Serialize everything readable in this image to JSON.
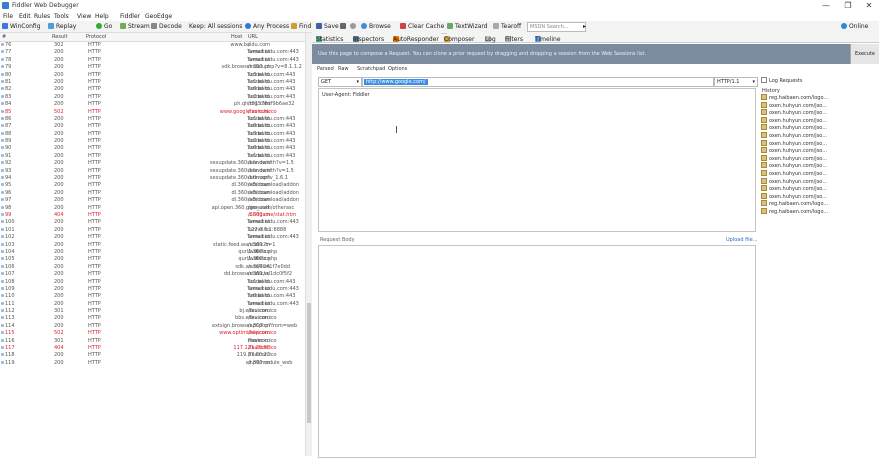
{
  "window": {
    "title": "Fiddler Web Debugger",
    "minimize": "—",
    "maximize": "❐",
    "close": "✕"
  },
  "menu": [
    "File",
    "Edit",
    "Rules",
    "Tools",
    "View",
    "Help",
    "Fiddler",
    "GeoEdge"
  ],
  "toolbar": {
    "winconfig": "WinConfig",
    "replay": "Replay",
    "go": "Go",
    "stream": "Stream",
    "decode": "Decode",
    "keep": "Keep: All sessions",
    "any_process": "Any Process",
    "find": "Find",
    "save": "Save",
    "browse": "Browse",
    "clear_cache": "Clear Cache",
    "textwizard": "TextWizard",
    "tearoff": "Tearoff",
    "search_placeholder": "MSDN Search...",
    "online": "Online"
  },
  "session_columns": [
    "#",
    "Result",
    "Protocol",
    "Host",
    "URL"
  ],
  "sessions": [
    [
      "76",
      "302",
      "HTTP",
      "www.baidu.com",
      "/"
    ],
    [
      "77",
      "200",
      "HTTP",
      "Tunnel to",
      "www.baidu.com:443"
    ],
    [
      "78",
      "200",
      "HTTP",
      "Tunnel to",
      "www.baidu.com:443"
    ],
    [
      "79",
      "200",
      "HTTP",
      "sdk.browser.360.cn",
      "/index.php?v=8.1.1.2"
    ],
    [
      "80",
      "200",
      "HTTP",
      "Tunnel to",
      "ss3.baidu.com:443"
    ],
    [
      "81",
      "200",
      "HTTP",
      "Tunnel to",
      "ss1.baidu.com:443"
    ],
    [
      "82",
      "200",
      "HTTP",
      "Tunnel to",
      "ss0.baidu.com:443"
    ],
    [
      "83",
      "200",
      "HTTP",
      "Tunnel to",
      "ss2.baidu.com:443"
    ],
    [
      "84",
      "200",
      "HTTP",
      "ph.qhimg.com",
      "/t01576df9b6ae32"
    ],
    [
      "85",
      "502",
      "HTTP",
      "www.google.com.hk",
      "/favicon.ico"
    ],
    [
      "86",
      "200",
      "HTTP",
      "Tunnel to",
      "ss1.baidu.com:443"
    ],
    [
      "87",
      "200",
      "HTTP",
      "Tunnel to",
      "ss0.baidu.com:443"
    ],
    [
      "88",
      "200",
      "HTTP",
      "Tunnel to",
      "ss3.baidu.com:443"
    ],
    [
      "89",
      "200",
      "HTTP",
      "Tunnel to",
      "ss2.baidu.com:443"
    ],
    [
      "90",
      "200",
      "HTTP",
      "Tunnel to",
      "ss0.baidu.com:443"
    ],
    [
      "91",
      "200",
      "HTTP",
      "Tunnel to",
      "ss1.baidu.com:443"
    ],
    [
      "92",
      "200",
      "HTTP",
      "sexupdate.360safe.com",
      "/bandwidth?v=1.5"
    ],
    [
      "93",
      "200",
      "HTTP",
      "sexupdate.360safe.com",
      "/bandwidth?v=1.5"
    ],
    [
      "94",
      "200",
      "HTTP",
      "sexupdate.360safe.com",
      "/bdmap?v_1.6.1"
    ],
    [
      "95",
      "200",
      "HTTP",
      "dl.360safe.com",
      "/v3/download/addon"
    ],
    [
      "96",
      "200",
      "HTTP",
      "dl.360safe.com",
      "/v3/download/addon"
    ],
    [
      "97",
      "200",
      "HTTP",
      "dl.360safe.com",
      "/v3/download/addon"
    ],
    [
      "98",
      "200",
      "HTTP",
      "api.open.360.game.net",
      "/gw_auth/otherasc"
    ],
    [
      "99",
      "404",
      "HTTP",
      "s.360.cn",
      "/360game/stat.htm"
    ],
    [
      "100",
      "200",
      "HTTP",
      "Tunnel to",
      "www.baidu.com:443"
    ],
    [
      "101",
      "200",
      "HTTP",
      "Tunnel to",
      "127.0.0.1:8888"
    ],
    [
      "102",
      "200",
      "HTTP",
      "Tunnel to",
      "www.baidu.com:443"
    ],
    [
      "103",
      "200",
      "HTTP",
      "static.feed.wan.360.cn",
      "/static?t=1"
    ],
    [
      "104",
      "200",
      "HTTP",
      "qurl1.360.cn",
      "/wdinfo.php"
    ],
    [
      "105",
      "200",
      "HTTP",
      "qurl1.360.cn",
      "/wdinfo.php"
    ],
    [
      "106",
      "200",
      "HTTP",
      "sdk.se.360.cn",
      "/sns/4041f7e0dd"
    ],
    [
      "107",
      "200",
      "HTTP",
      "dd.browser.360.cn",
      "/static/a/1dc0f5f2"
    ],
    [
      "108",
      "200",
      "HTTP",
      "Tunnel to",
      "ss1.baidu.com:443"
    ],
    [
      "109",
      "200",
      "HTTP",
      "Tunnel to",
      "www.baidu.com:443"
    ],
    [
      "110",
      "200",
      "HTTP",
      "Tunnel to",
      "ss0.baidu.com:443"
    ],
    [
      "111",
      "200",
      "HTTP",
      "Tunnel to",
      "www.baidu.com:443"
    ],
    [
      "112",
      "301",
      "HTTP",
      "bj.edcu.com",
      "/favicon.ico"
    ],
    [
      "113",
      "200",
      "HTTP",
      "bbs.edcu.com",
      "/favicon.ico"
    ],
    [
      "114",
      "200",
      "HTTP",
      "extsign.browser.360.cn",
      "/api.php?from=web"
    ],
    [
      "115",
      "502",
      "HTTP",
      "www.optimizely.com",
      "/favicon.ico"
    ],
    [
      "116",
      "301",
      "HTTP",
      "hower.cn",
      "/favicon.ico"
    ],
    [
      "117",
      "404",
      "HTTP",
      "117.121.29.68",
      "/favicon.ico"
    ],
    [
      "118",
      "200",
      "HTTP",
      "119.97.90.23",
      "/favicon.ico"
    ],
    [
      "119",
      "200",
      "HTTP",
      "se.360.cn",
      "/hp9/module_web"
    ]
  ],
  "error_sessions": [
    "85",
    "99",
    "115",
    "117"
  ],
  "right_tabs": [
    "Statistics",
    "Inspectors",
    "AutoResponder",
    "Composer",
    "Log",
    "Filters",
    "Timeline"
  ],
  "composer": {
    "info": "Use this page to compose a Request. You can clone a prior request by dragging and dropping a session from the Web Sessions list.",
    "execute": "Execute",
    "subtabs": [
      "Parsed",
      "Raw",
      "Scratchpad",
      "Options"
    ],
    "method": "GET",
    "url": "http://www.google.com/",
    "protocol": "HTTP/1.1",
    "headers": "User-Agent: Fiddler",
    "request_body_label": "Request Body",
    "upload_file": "Upload file...",
    "log_requests": "Log Requests",
    "history_label": "History",
    "history": [
      "reg.haibaen.com/logo...",
      "oxen.huhyun.com/jso...",
      "oxen.huhyun.com/jso...",
      "oxen.huhyun.com/jso...",
      "oxen.huhyun.com/jso...",
      "oxen.huhyun.com/jso...",
      "oxen.huhyun.com/jso...",
      "oxen.huhyun.com/jso...",
      "oxen.huhyun.com/jso...",
      "oxen.huhyun.com/jso...",
      "oxen.huhyun.com/jso...",
      "oxen.huhyun.com/jso...",
      "oxen.huhyun.com/jso...",
      "oxen.huhyun.com/jso...",
      "reg.haibaen.com/logo...",
      "reg.haibaen.com/logo..."
    ]
  },
  "colors": {
    "info_bar": "#7b8c9e",
    "error_text": "#d8242f",
    "url_selection": "#3c8de6"
  }
}
